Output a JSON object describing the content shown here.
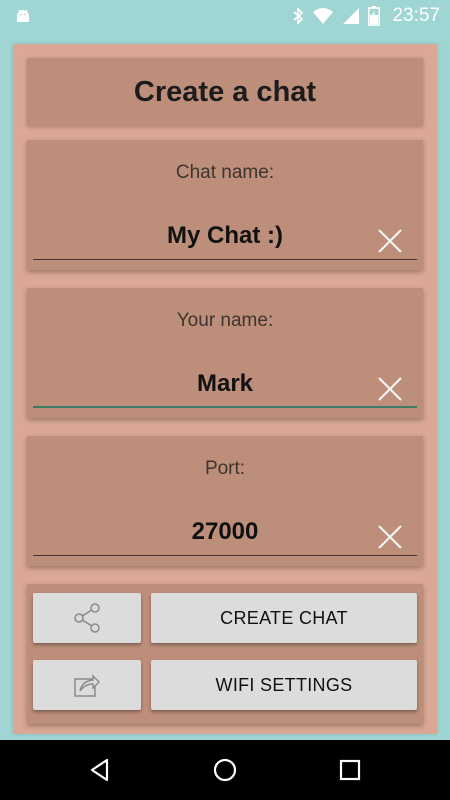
{
  "status_bar": {
    "time": "23:57",
    "icons": [
      "android-icon",
      "bluetooth-icon",
      "wifi-icon",
      "signal-icon",
      "battery-icon"
    ]
  },
  "title": "Create a chat",
  "fields": [
    {
      "label": "Chat name:",
      "value": "My Chat :)",
      "focused": false
    },
    {
      "label": "Your name:",
      "value": "Mark",
      "focused": true
    },
    {
      "label": "Port:",
      "value": "27000",
      "focused": false
    }
  ],
  "buttons": {
    "share_icon": "share-icon",
    "create_label": "CREATE CHAT",
    "export_icon": "export-icon",
    "wifi_label": "WIFI SETTINGS"
  },
  "navbar": {
    "icons": [
      "back-icon",
      "home-icon",
      "recents-icon"
    ]
  },
  "colors": {
    "background": "#9fd6d3",
    "panel": "#dba895",
    "card": "#bd8e7a",
    "button": "#dcdcdc",
    "focus_underline": "#3f7a67"
  }
}
